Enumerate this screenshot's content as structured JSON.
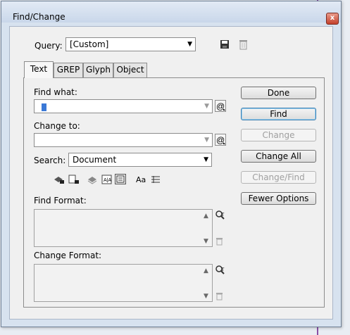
{
  "window": {
    "title": "Find/Change",
    "close_glyph": "x"
  },
  "query": {
    "label": "Query:",
    "value": "[Custom]"
  },
  "tabs": [
    {
      "label": "Text",
      "active": true
    },
    {
      "label": "GREP",
      "active": false
    },
    {
      "label": "Glyph",
      "active": false
    },
    {
      "label": "Object",
      "active": false
    }
  ],
  "find_what": {
    "label": "Find what:",
    "value": ""
  },
  "change_to": {
    "label": "Change to:",
    "value": ""
  },
  "search": {
    "label": "Search:",
    "value": "Document"
  },
  "find_format": {
    "label": "Find Format:"
  },
  "change_format": {
    "label": "Change Format:"
  },
  "buttons": {
    "done": "Done",
    "find": "Find",
    "change": "Change",
    "change_all": "Change All",
    "change_find": "Change/Find",
    "fewer_options": "Fewer Options"
  },
  "icons": {
    "save_query": "floppy-disk-icon",
    "delete_query": "trash-icon",
    "special_chars": "at-sign-icon",
    "aa": "Aa",
    "search_options": [
      "include-locked-layers-icon",
      "include-locked-stories-icon",
      "include-hidden-layers-icon",
      "include-master-pages-icon",
      "include-footnotes-icon",
      "case-sensitive-icon",
      "whole-word-icon"
    ]
  }
}
